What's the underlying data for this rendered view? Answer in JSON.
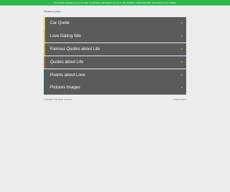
{
  "banner": {
    "text": "The domain carquotes.com is for sale. To purchase, call Afternic.com at +1 781-373-6847 or 855-201-2286. Click here for more details."
  },
  "related_title": "Related Links",
  "links": [
    {
      "label": "Car Quote",
      "chevron": "»",
      "accent": "#e6c54a"
    },
    {
      "label": "Love Dating Site",
      "chevron": "»",
      "accent": "#d4b640"
    },
    {
      "label": "Famous Quotes about Life",
      "chevron": "»",
      "accent": "#cfa73c"
    },
    {
      "label": "Quotes about Life",
      "chevron": "»",
      "accent": "#b56a3a"
    },
    {
      "label": "Poems about Love",
      "chevron": "»",
      "accent": "#2a6e6e"
    },
    {
      "label": "Pictures Images",
      "chevron": "»",
      "accent": "#3c5f5f"
    }
  ],
  "footer": {
    "copyright": "Copyright © All rights reserved.",
    "privacy": "Privacy Policy"
  },
  "colors": {
    "banner": "#2db84b",
    "item_bg": "#5a5a5a",
    "chevron": "#e6b422",
    "page_bg": "#ececec"
  }
}
